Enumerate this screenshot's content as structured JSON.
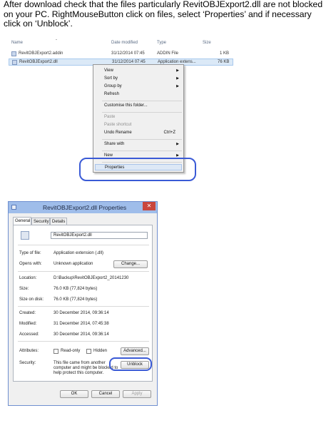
{
  "instructions": "After download check that the files particularly RevitOBJExport2.dll are not blocked on your PC. RightMouseButton click on files, select ‘Properties’ and if necessary click on ‘Unblock’.",
  "explorer": {
    "columns": {
      "name": "Name",
      "date": "Date modified",
      "type": "Type",
      "size": "Size"
    },
    "rows": [
      {
        "name": "RevitOBJExport2.addin",
        "date": "31/12/2014 07:45",
        "type": "ADDIN File",
        "size": "1 KB"
      },
      {
        "name": "RevitOBJExport2.dll",
        "date": "31/12/2014 07:45",
        "type": "Application extens...",
        "size": "76 KB"
      }
    ]
  },
  "context_menu": {
    "view": "View",
    "sort_by": "Sort by",
    "group_by": "Group by",
    "refresh": "Refresh",
    "customise": "Customise this folder...",
    "paste": "Paste",
    "paste_shortcut": "Paste shortcut",
    "undo_rename": "Undo Rename",
    "undo_shortcut": "Ctrl+Z",
    "share_with": "Share with",
    "new": "New",
    "properties": "Properties"
  },
  "dialog": {
    "title": "RevitOBJExport2.dll Properties",
    "close": "✕",
    "tabs": [
      "General",
      "Security",
      "Details"
    ],
    "filename": "RevitOBJExport2.dll",
    "type_label": "Type of file:",
    "type_value": "Application extension (.dll)",
    "opens_label": "Opens with:",
    "opens_value": "Unknown application",
    "change_button": "Change...",
    "location_label": "Location:",
    "location_value": "D:\\Backup\\RevitOBJExport2_20141230",
    "size_label": "Size:",
    "size_value": "76.0 KB (77,824 bytes)",
    "size_disk_label": "Size on disk:",
    "size_disk_value": "76.0 KB (77,824 bytes)",
    "created_label": "Created:",
    "created_value": "30 December 2014, 09:36:14",
    "modified_label": "Modified:",
    "modified_value": "31 December 2014, 07:45:38",
    "accessed_label": "Accessed:",
    "accessed_value": "30 December 2014, 09:36:14",
    "attributes_label": "Attributes:",
    "readonly_label": "Read-only",
    "hidden_label": "Hidden",
    "advanced_button": "Advanced...",
    "security_label": "Security:",
    "security_line1": "This file came from another",
    "security_line2": "computer and might be blocked to",
    "security_line3": "help protect this computer.",
    "unblock_button": "Unblock",
    "ok_button": "OK",
    "cancel_button": "Cancel",
    "apply_button": "Apply"
  }
}
